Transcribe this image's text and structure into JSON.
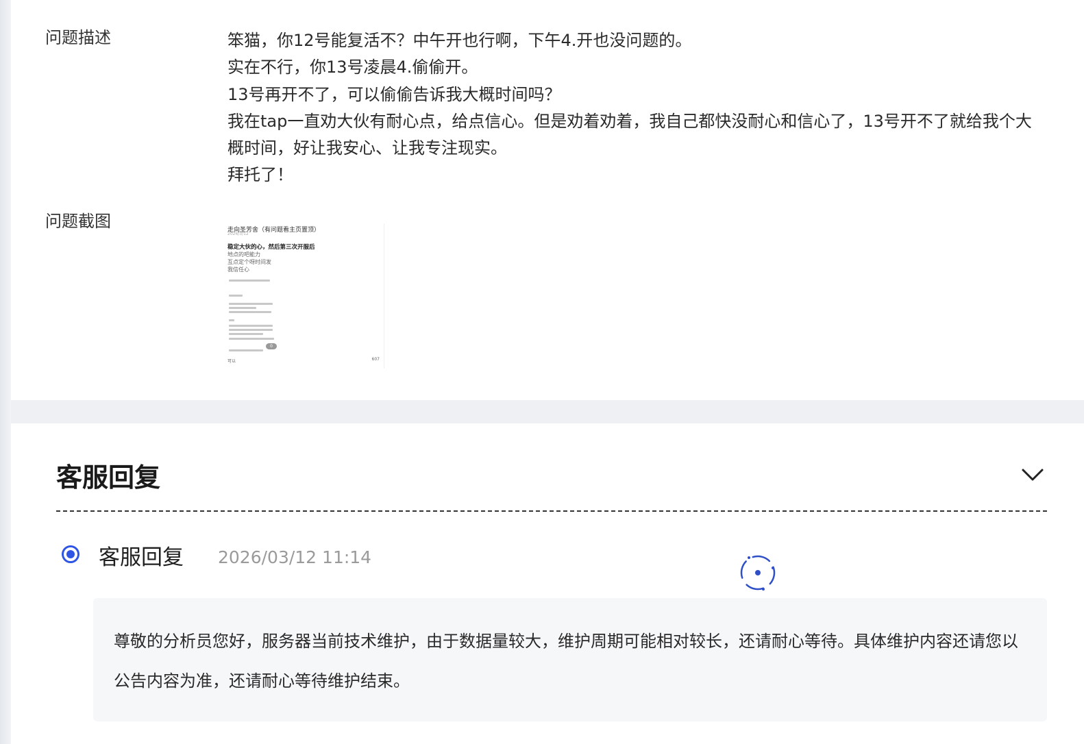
{
  "problem": {
    "desc_label": "问题描述",
    "desc_lines": [
      "笨猫，你12号能复活不？中午开也行啊，下午4.开也没问题的。",
      "实在不行，你13号凌晨4.偷偷开。",
      "13号再开不了，可以偷偷告诉我大概时间吗？",
      "我在tap一直劝大伙有耐心点，给点信心。但是劝着劝着，我自己都快没耐心和信心了，13号开不了就给我个大概时间，好让我安心、让我专注现实。",
      "拜托了！"
    ],
    "screenshot_label": "问题截图",
    "thumbnail": {
      "head": "走向圣芳舍（有问题看主页置顶）",
      "date": "2026/3/12",
      "title": "稳定大伙的心，然后第三次开服后",
      "sub_lines": [
        "地点的吧能力",
        "互点定个呀时间发",
        "我信任心"
      ],
      "badge": "0",
      "foot_left": "可以",
      "foot_right": "607"
    }
  },
  "service": {
    "section_title": "客服回复",
    "reply_name": "客服回复",
    "reply_time": "2026/03/12 11:14",
    "reply_body": "尊敬的分析员您好，服务器当前技术维护，由于数据量较大，维护周期可能相对较长，还请耐心等待。具体维护内容还请您以公告内容为准，还请耐心等待维护结束。"
  },
  "colors": {
    "accent": "#2f55e4",
    "timestamp": "#9a9a9a",
    "reply_bg": "#f6f7f9"
  },
  "icons": {
    "collapse": "chevron-down-icon",
    "status": "radio-selected-icon",
    "loading": "loading-spinner-icon"
  }
}
